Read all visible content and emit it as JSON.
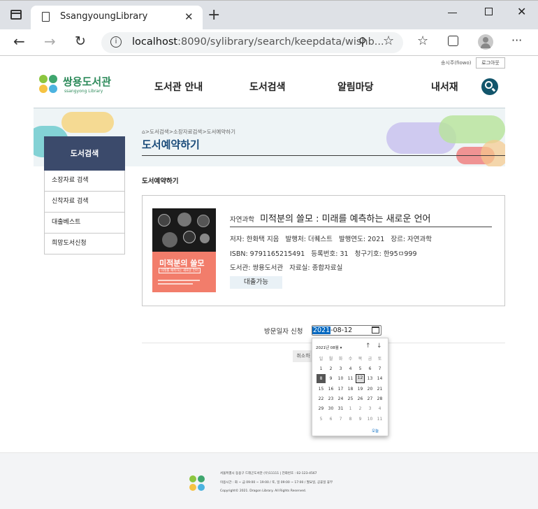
{
  "browser": {
    "tab_title": "SsangyoungLibrary",
    "url_host": "localhost",
    "url_rest": ":8090/sylibrary/search/keepdata/wishb...",
    "icons": [
      "sidebar-icon",
      "page-icon",
      "close-icon",
      "new-tab-icon",
      "minimize-icon",
      "maximize-icon",
      "window-close-icon",
      "back-icon",
      "forward-icon",
      "reload-icon",
      "info-icon",
      "zoom-icon",
      "add-favorite-icon",
      "favorites-icon",
      "collections-icon",
      "profile-icon",
      "more-icon"
    ]
  },
  "topbar": {
    "user": "송시주(fiowo)",
    "logout": "로그아웃"
  },
  "header": {
    "logo_title": "쌍용도서관",
    "logo_sub": "ssangyong Library",
    "nav": [
      "도서관 안내",
      "도서검색",
      "알림마당",
      "내서재"
    ]
  },
  "banner": {
    "breadcrumb": ">도서검색>소장자료검색>도서예약하기",
    "title": "도서예약하기"
  },
  "sidebar": {
    "heading": "도서검색",
    "items": [
      "소장자료 검색",
      "신착자료 검색",
      "대출베스트",
      "희망도서신청"
    ]
  },
  "main": {
    "section_title": "도서예약하기",
    "book": {
      "category": "자연과학",
      "title": "미적분의 쓸모 : 미래를 예측하는 새로운 언어",
      "line1": "저자: 한화택 지음   발행처: 더퀘스트   발행연도: 2021   장르: 자연과학",
      "line2": "ISBN: 9791165215491   등록번호: 31   청구기호: 한95ㅁ999",
      "line3": "도서관: 쌍용도서관   자료실: 종합자료실",
      "status": "대출가능",
      "cover_title": "미적분의 쓸모",
      "cover_sub": "미래를 예측하는 새로운 언어"
    },
    "visit_label": "방문일자 신청",
    "date_year": "2021",
    "date_rest": "-08-12",
    "cancel_label": "취소하"
  },
  "datepicker": {
    "month_label": "2021년 08월 ▾",
    "weekdays": [
      "일",
      "월",
      "화",
      "수",
      "목",
      "금",
      "토"
    ],
    "rows": [
      [
        "1",
        "2",
        "3",
        "4",
        "5",
        "6",
        "7"
      ],
      [
        "8",
        "9",
        "10",
        "11",
        "12",
        "13",
        "14"
      ],
      [
        "15",
        "16",
        "17",
        "18",
        "19",
        "20",
        "21"
      ],
      [
        "22",
        "23",
        "24",
        "25",
        "26",
        "27",
        "28"
      ],
      [
        "29",
        "30",
        "31",
        "1",
        "2",
        "3",
        "4"
      ],
      [
        "5",
        "6",
        "7",
        "8",
        "9",
        "10",
        "11"
      ]
    ],
    "today_label": "오늘",
    "selected": "12",
    "current": "8"
  },
  "footer": {
    "line1": "서울특별시 동용구 드래곤도서관 (우)11111 | 전화번호 : 02-123-4567",
    "line2": "이용시간 : 화 ~ 금 09:00 ~ 19:00 / 토, 일 09:00 ~ 17:00 / 월요일, 공휴일 휴무",
    "line3": "Copyright© 2021. Dragon Library. All Rights Reserved."
  },
  "colors": {
    "nav_dark": "#3b4a6b",
    "accent_green": "#2d8a5a",
    "search_button": "#12556b",
    "cover_salmon": "#f27d6b"
  }
}
